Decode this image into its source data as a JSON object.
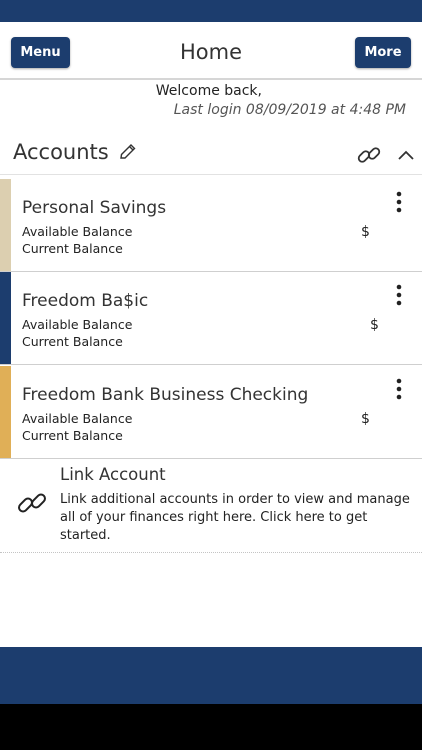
{
  "header": {
    "menu_label": "Menu",
    "title": "Home",
    "more_label": "More"
  },
  "welcome": {
    "greeting": "Welcome back,",
    "last_login": "Last login 08/09/2019 at 4:48 PM"
  },
  "accounts": {
    "section_title": "Accounts",
    "edit_icon": "pencil-icon",
    "link_icon": "link-icon",
    "collapse_icon": "chevron-up-icon",
    "items": [
      {
        "name": "Personal Savings",
        "available_label": "Available Balance",
        "current_label": "Current Balance",
        "available_value": "$",
        "color": "#dccfb0"
      },
      {
        "name": "Freedom Ba$ic",
        "available_label": "Available Balance",
        "current_label": "Current Balance",
        "available_value": "$",
        "color": "#1c3d6e"
      },
      {
        "name": "Freedom Bank Business Checking",
        "available_label": "Available Balance",
        "current_label": "Current Balance",
        "available_value": "$",
        "color": "#e0af57"
      }
    ]
  },
  "link_account": {
    "title": "Link Account",
    "description": "Link additional accounts in order to view and manage all of your finances right here. Click here to get started.",
    "icon": "link-icon"
  },
  "colors": {
    "brand_navy": "#1c3d6e",
    "savings_stripe": "#dccfb0",
    "basic_stripe": "#1c3d6e",
    "business_stripe": "#e0af57"
  }
}
